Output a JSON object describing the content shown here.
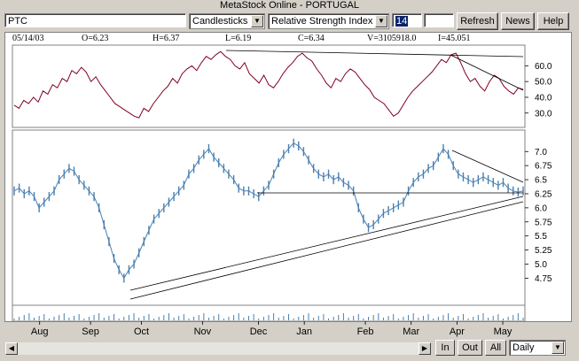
{
  "window": {
    "title": "MetaStock Online - PORTUGAL"
  },
  "toolbar": {
    "symbol_value": "PTC",
    "chart_type": "Candlesticks",
    "indicator": "Relative Strength Index",
    "period_value": "14",
    "extra_value": "",
    "refresh_label": "Refresh",
    "news_label": "News",
    "help_label": "Help"
  },
  "info": {
    "date": "05/14/03",
    "open": "O=6.23",
    "high": "H=6.37",
    "low": "L=6.19",
    "close": "C=6.34",
    "volume": "V=3105918.0",
    "indicator": "I=45.051"
  },
  "bottom": {
    "in_label": "In",
    "out_label": "Out",
    "all_label": "All",
    "period_select": "Daily"
  },
  "chart_data": [
    {
      "type": "line",
      "name": "rsi-panel",
      "y_ticks": [
        "60.0",
        "50.0",
        "40.0",
        "30.0"
      ],
      "y_tick_values": [
        60,
        50,
        40,
        30
      ],
      "ylim": [
        22,
        72
      ],
      "values": [
        35,
        33,
        38,
        36,
        40,
        37,
        44,
        42,
        48,
        46,
        52,
        50,
        57,
        55,
        59,
        56,
        50,
        53,
        48,
        44,
        40,
        36,
        34,
        32,
        30,
        28,
        27,
        33,
        31,
        36,
        40,
        44,
        47,
        52,
        49,
        55,
        58,
        60,
        57,
        62,
        66,
        64,
        67,
        69,
        66,
        64,
        60,
        58,
        62,
        55,
        52,
        49,
        54,
        48,
        46,
        50,
        55,
        59,
        62,
        66,
        68,
        65,
        63,
        58,
        54,
        49,
        46,
        52,
        50,
        55,
        58,
        56,
        52,
        48,
        45,
        40,
        38,
        36,
        32,
        28,
        30,
        35,
        40,
        44,
        47,
        50,
        53,
        56,
        60,
        64,
        62,
        67,
        68,
        62,
        55,
        50,
        52,
        47,
        44,
        50,
        54,
        52,
        47,
        44,
        42,
        46,
        45
      ],
      "line_color": "#800020"
    },
    {
      "type": "line",
      "name": "price-panel",
      "y_ticks": [
        "7.0",
        "6.75",
        "6.5",
        "6.25",
        "6.0",
        "5.75",
        "5.5",
        "5.25",
        "5.0",
        "4.75"
      ],
      "y_tick_values": [
        7.0,
        6.75,
        6.5,
        6.25,
        6.0,
        5.75,
        5.5,
        5.25,
        5.0,
        4.75
      ],
      "ylim": [
        4.3,
        7.35
      ],
      "values": [
        6.3,
        6.35,
        6.25,
        6.3,
        6.2,
        6.0,
        6.1,
        6.2,
        6.3,
        6.5,
        6.6,
        6.7,
        6.65,
        6.5,
        6.4,
        6.3,
        6.2,
        6.0,
        5.7,
        5.4,
        5.1,
        4.9,
        4.75,
        4.9,
        5.0,
        5.2,
        5.4,
        5.6,
        5.8,
        5.9,
        6.0,
        6.1,
        6.2,
        6.3,
        6.4,
        6.6,
        6.7,
        6.85,
        6.95,
        7.05,
        6.9,
        6.8,
        6.7,
        6.6,
        6.5,
        6.35,
        6.3,
        6.3,
        6.25,
        6.2,
        6.3,
        6.4,
        6.6,
        6.8,
        6.95,
        7.05,
        7.15,
        7.1,
        7.0,
        6.85,
        6.7,
        6.6,
        6.55,
        6.6,
        6.5,
        6.55,
        6.45,
        6.4,
        6.3,
        6.0,
        5.8,
        5.65,
        5.7,
        5.8,
        5.9,
        5.95,
        6.0,
        6.05,
        6.1,
        6.3,
        6.45,
        6.55,
        6.6,
        6.7,
        6.75,
        6.9,
        7.05,
        6.95,
        6.75,
        6.6,
        6.55,
        6.5,
        6.45,
        6.5,
        6.55,
        6.5,
        6.45,
        6.4,
        6.45,
        6.35,
        6.3,
        6.28,
        6.3
      ],
      "line_color": "#4a7fb0"
    }
  ],
  "x_axis": {
    "labels": [
      "Aug",
      "Sep",
      "Oct",
      "Nov",
      "Dec",
      "Jan",
      "Feb",
      "Mar",
      "Apr",
      "May"
    ],
    "label_fracs": [
      0.05,
      0.15,
      0.25,
      0.37,
      0.48,
      0.57,
      0.69,
      0.78,
      0.87,
      0.96
    ]
  }
}
